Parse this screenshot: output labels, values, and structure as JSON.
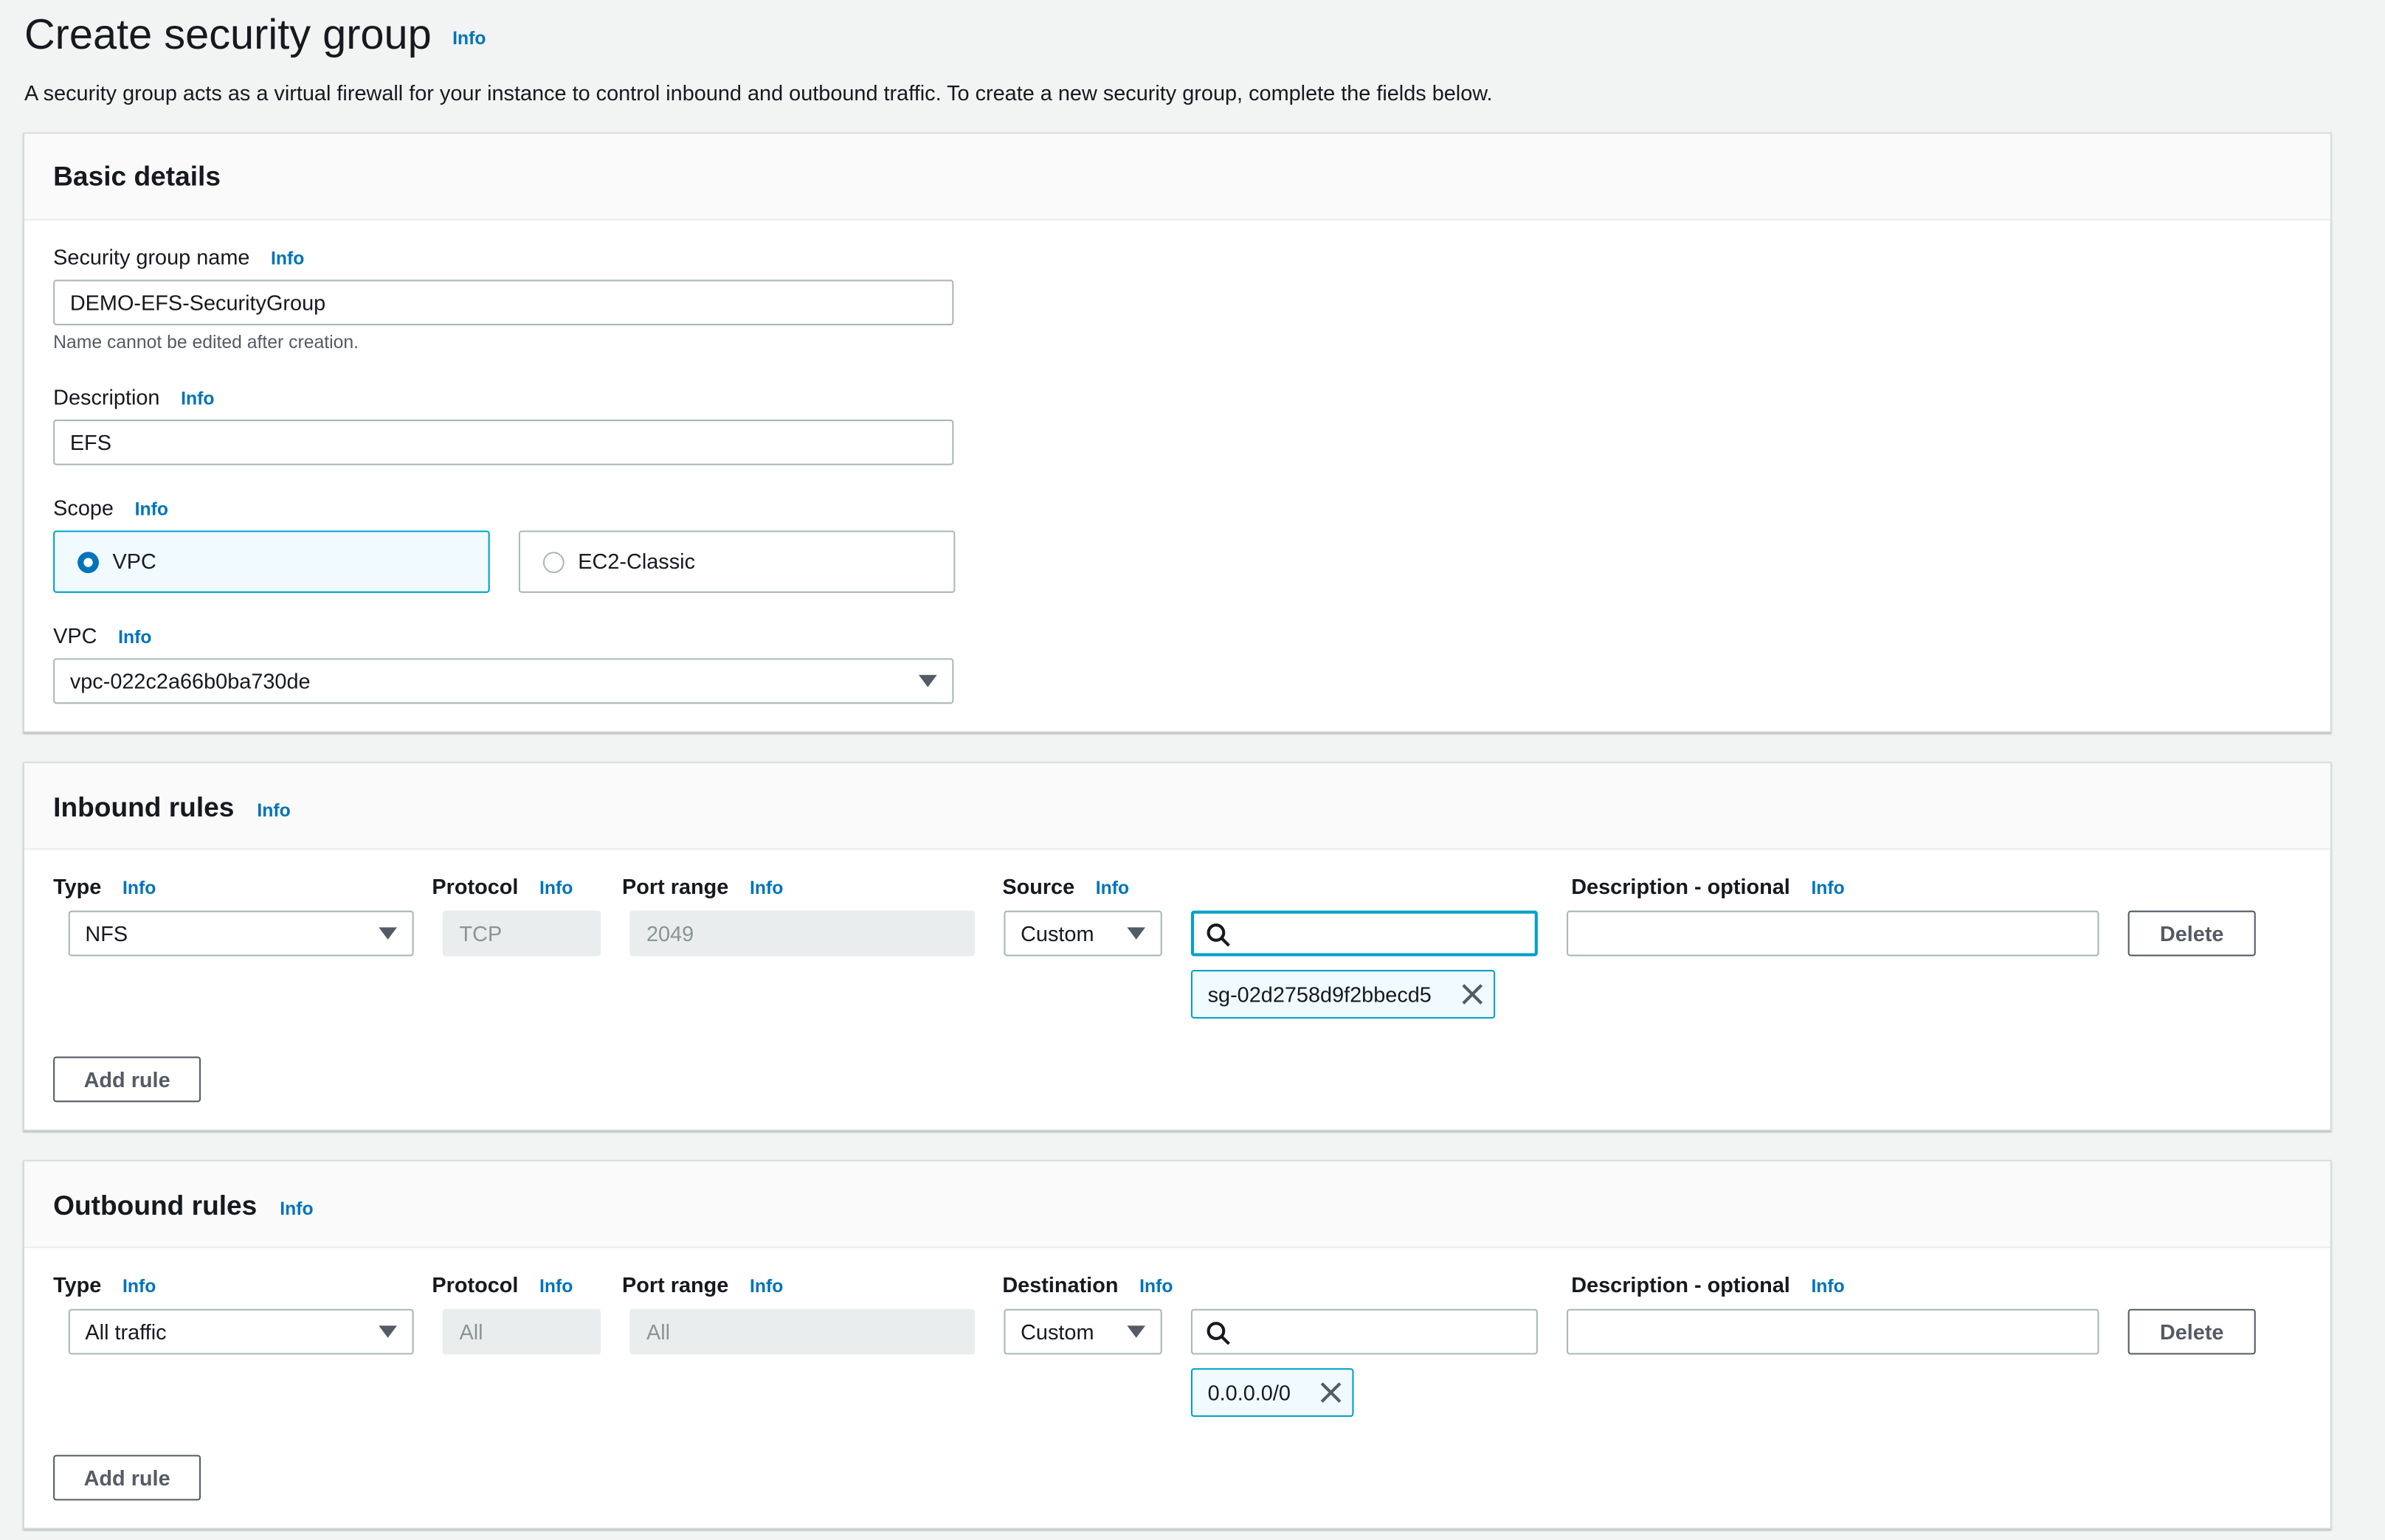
{
  "page": {
    "title": "Create security group",
    "title_info": "Info",
    "intro": "A security group acts as a virtual firewall for your instance to control inbound and outbound traffic. To create a new security group, complete the fields below."
  },
  "basic": {
    "heading": "Basic details",
    "name_label": "Security group name",
    "name_info": "Info",
    "name_value": "DEMO-EFS-SecurityGroup",
    "name_help": "Name cannot be edited after creation.",
    "desc_label": "Description",
    "desc_info": "Info",
    "desc_value": "EFS",
    "scope_label": "Scope",
    "scope_info": "Info",
    "scope_options": [
      {
        "label": "VPC",
        "selected": true
      },
      {
        "label": "EC2-Classic",
        "selected": false
      }
    ],
    "vpc_label": "VPC",
    "vpc_info": "Info",
    "vpc_value": "vpc-022c2a66b0ba730de"
  },
  "inbound": {
    "heading": "Inbound rules",
    "info": "Info",
    "columns": {
      "type": "Type",
      "type_info": "Info",
      "protocol": "Protocol",
      "protocol_info": "Info",
      "port": "Port range",
      "port_info": "Info",
      "source": "Source",
      "source_info": "Info",
      "desc": "Description - optional",
      "desc_info": "Info"
    },
    "rule": {
      "type": "NFS",
      "protocol": "TCP",
      "port": "2049",
      "source_mode": "Custom",
      "search_value": "",
      "token": "sg-02d2758d9f2bbecd5",
      "description": "",
      "delete_label": "Delete"
    },
    "add_label": "Add rule"
  },
  "outbound": {
    "heading": "Outbound rules",
    "info": "Info",
    "columns": {
      "type": "Type",
      "type_info": "Info",
      "protocol": "Protocol",
      "protocol_info": "Info",
      "port": "Port range",
      "port_info": "Info",
      "dest": "Destination",
      "dest_info": "Info",
      "desc": "Description - optional",
      "desc_info": "Info"
    },
    "rule": {
      "type": "All traffic",
      "protocol": "All",
      "port": "All",
      "dest_mode": "Custom",
      "search_value": "",
      "token": "0.0.0.0/0",
      "description": "",
      "delete_label": "Delete"
    },
    "add_label": "Add rule"
  },
  "colors": {
    "accent": "#0073bb",
    "focus": "#00a1c9",
    "background": "#f2f3f3"
  },
  "icons": [
    "search-icon",
    "close-icon",
    "caret-down-icon",
    "radio-icon"
  ]
}
